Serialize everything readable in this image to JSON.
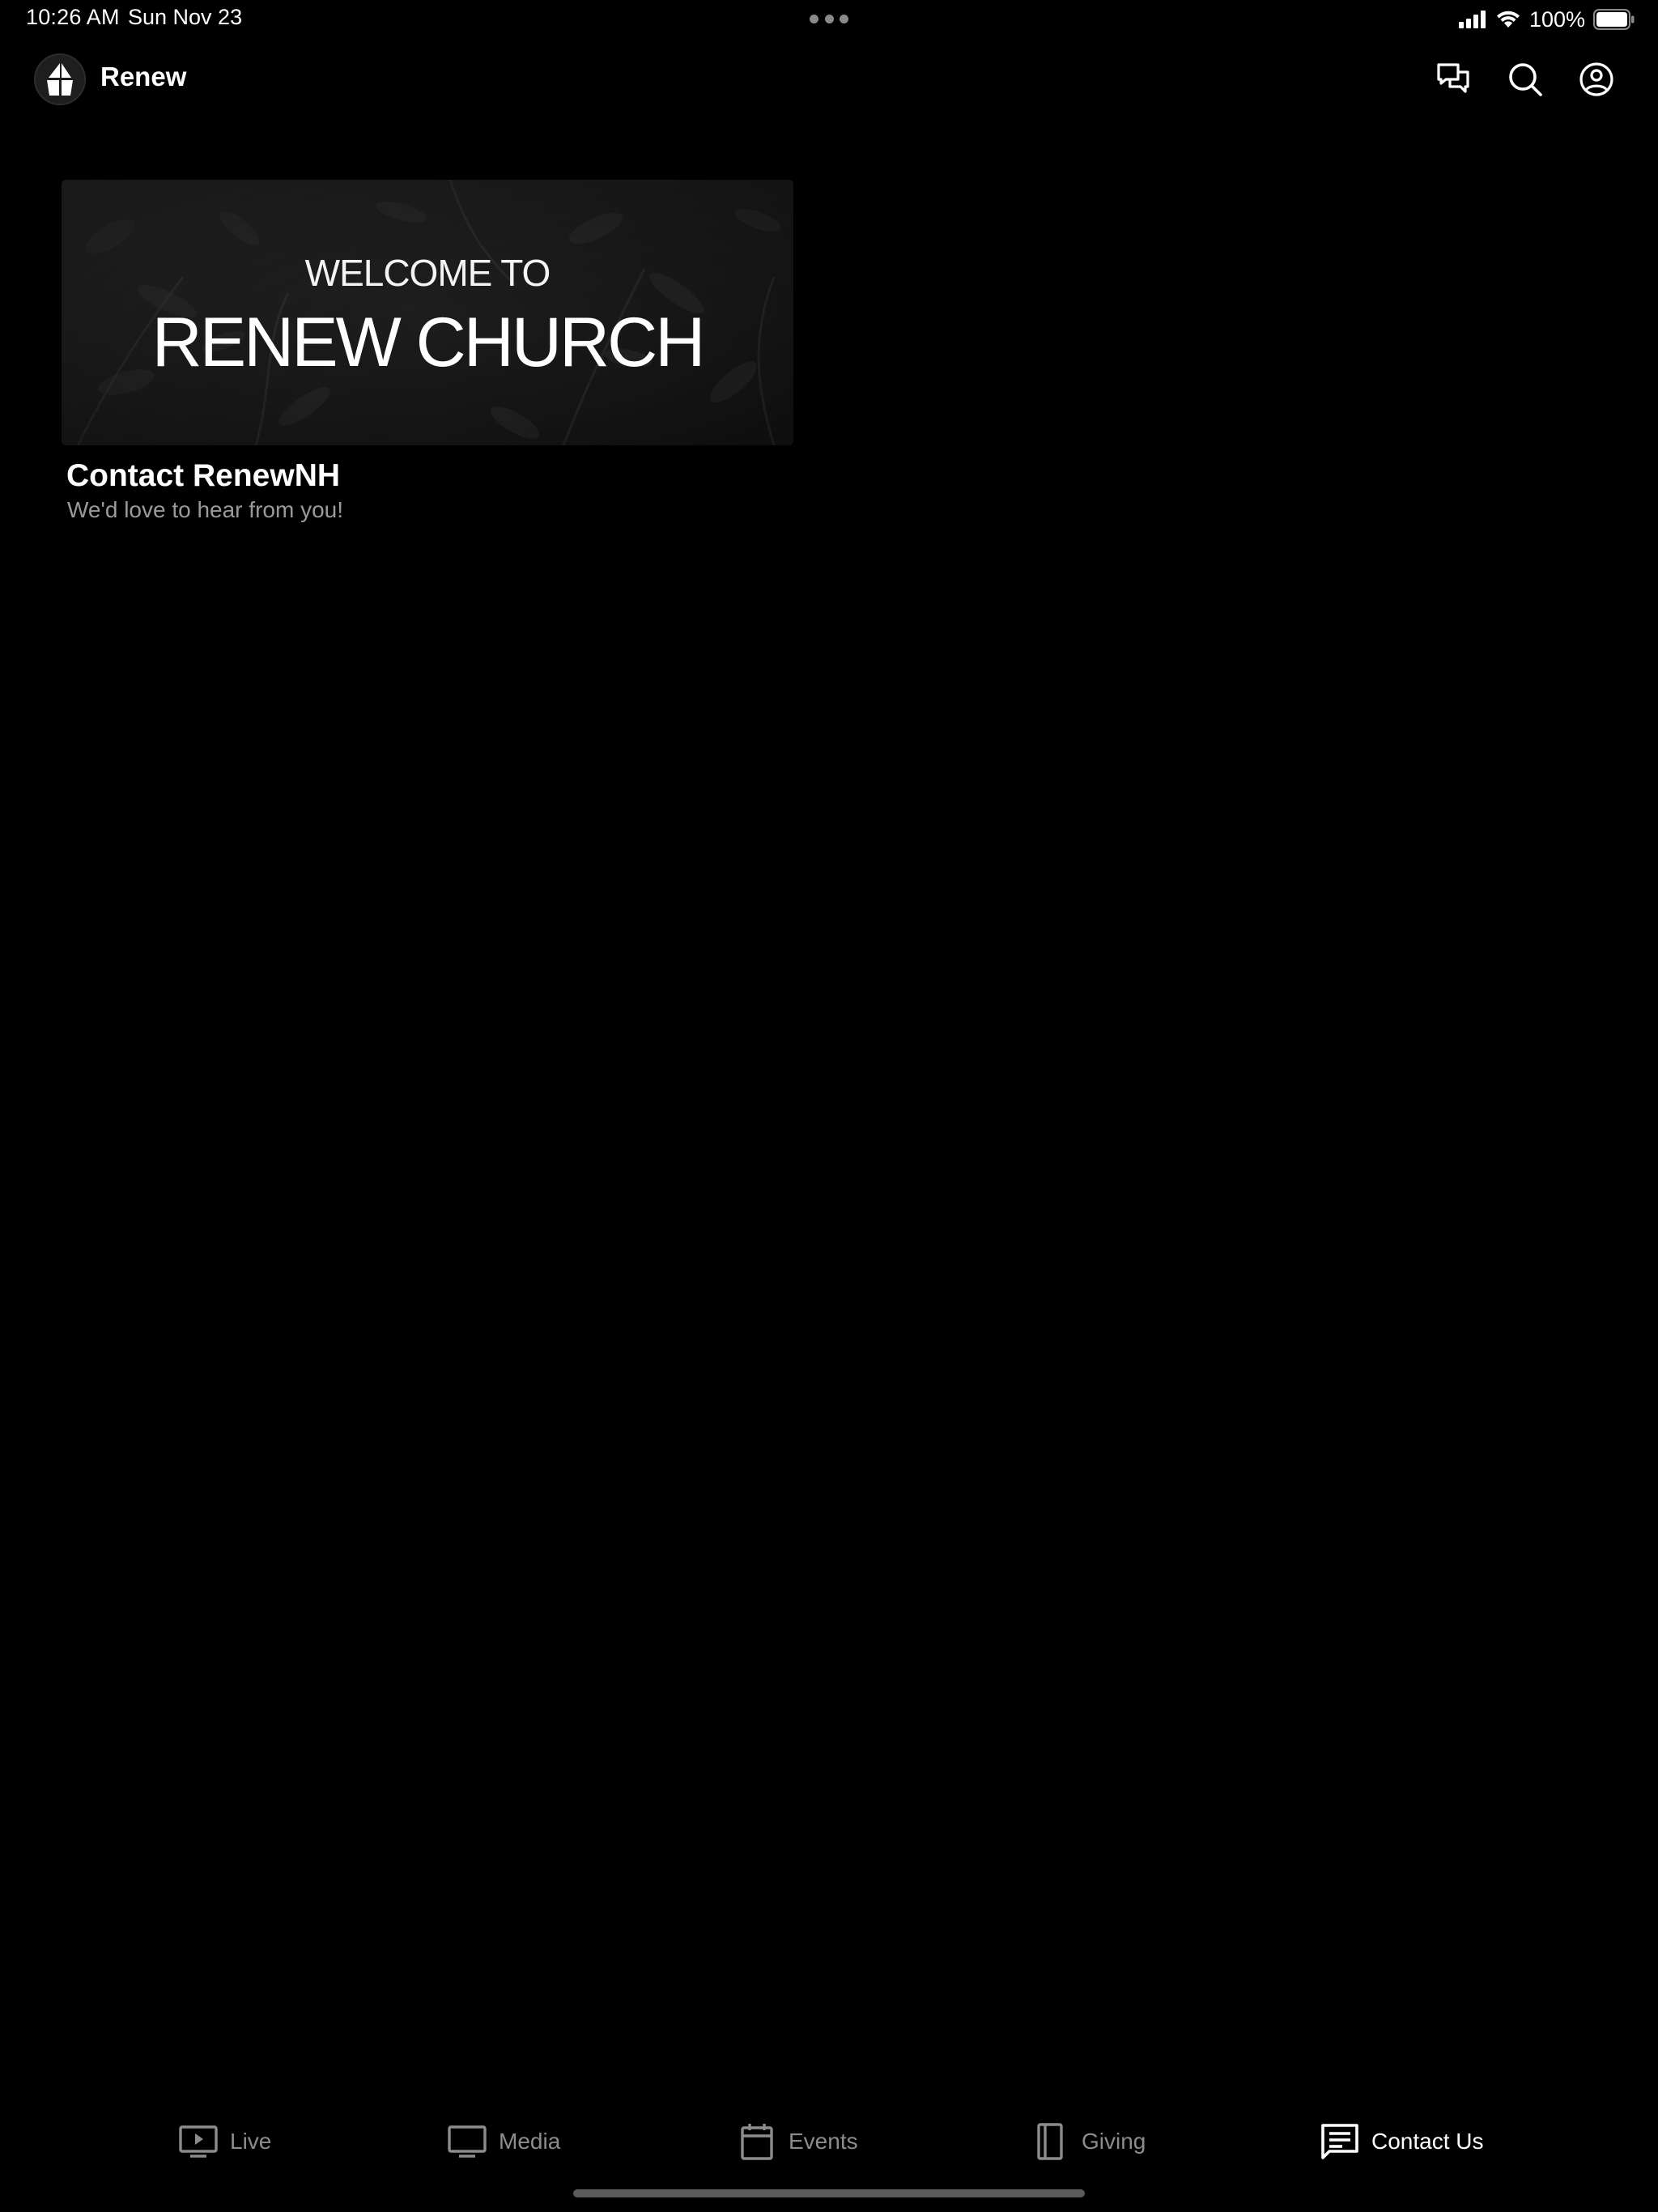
{
  "status_bar": {
    "time": "10:26 AM",
    "date": "Sun Nov 23",
    "battery": "100%"
  },
  "app_bar": {
    "app_name": "Renew",
    "icons": [
      "chat-icon",
      "search-icon",
      "account-icon"
    ]
  },
  "hero": {
    "welcome_text": "WELCOME TO",
    "church_text": "RENEW CHURCH",
    "title": "Contact RenewNH",
    "subtitle": "We'd love to hear from you!"
  },
  "tabs": [
    {
      "label": "Live",
      "icon": "live-icon",
      "active": false
    },
    {
      "label": "Media",
      "icon": "monitor-icon",
      "active": false
    },
    {
      "label": "Events",
      "icon": "calendar-icon",
      "active": false
    },
    {
      "label": "Giving",
      "icon": "book-icon",
      "active": false
    },
    {
      "label": "Contact Us",
      "icon": "message-icon",
      "active": true
    }
  ],
  "colors": {
    "background": "#000000",
    "text_primary": "#ffffff",
    "text_secondary": "#9a9a9a",
    "tab_inactive": "#8c8c8c"
  }
}
